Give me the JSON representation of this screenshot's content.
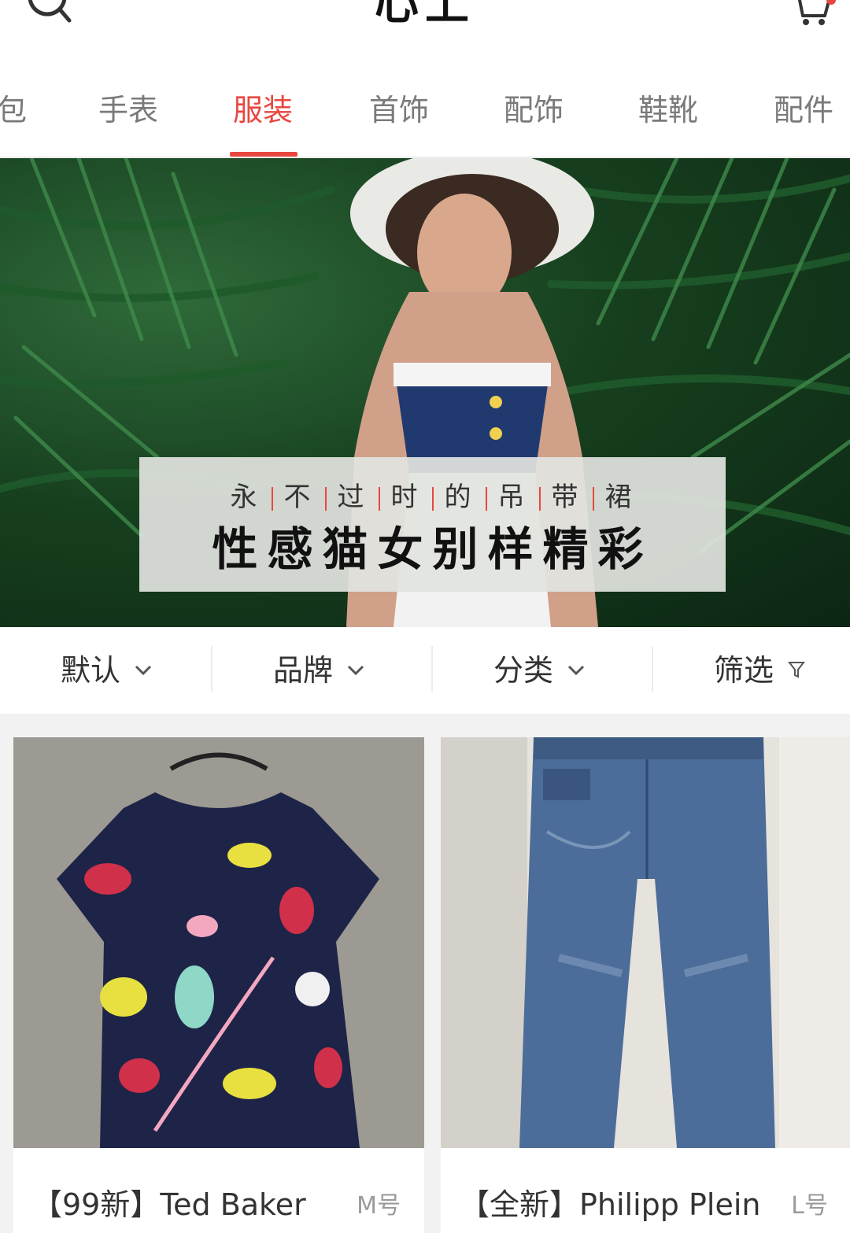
{
  "header": {
    "logo": "心上",
    "search_icon": "search-icon",
    "cart_icon": "cart-icon"
  },
  "tabs": [
    {
      "label": "包"
    },
    {
      "label": "手表"
    },
    {
      "label": "服装"
    },
    {
      "label": "首饰"
    },
    {
      "label": "配饰"
    },
    {
      "label": "鞋靴"
    },
    {
      "label": "配件"
    }
  ],
  "active_tab": "服装",
  "banner": {
    "subtitle_chars": [
      "永",
      "不",
      "过",
      "时",
      "的",
      "吊",
      "带",
      "裙"
    ],
    "title": "性感猫女别样精彩"
  },
  "filters": [
    {
      "label": "默认",
      "icon": "chevron-down-icon"
    },
    {
      "label": "品牌",
      "icon": "chevron-down-icon"
    },
    {
      "label": "分类",
      "icon": "chevron-down-icon"
    },
    {
      "label": "筛选",
      "icon": "filter-icon"
    }
  ],
  "products": [
    {
      "name": "【99新】Ted Baker",
      "size": "M号"
    },
    {
      "name": "【全新】Philipp Plein",
      "size": "L号"
    }
  ],
  "colors": {
    "accent": "#e8473f"
  }
}
